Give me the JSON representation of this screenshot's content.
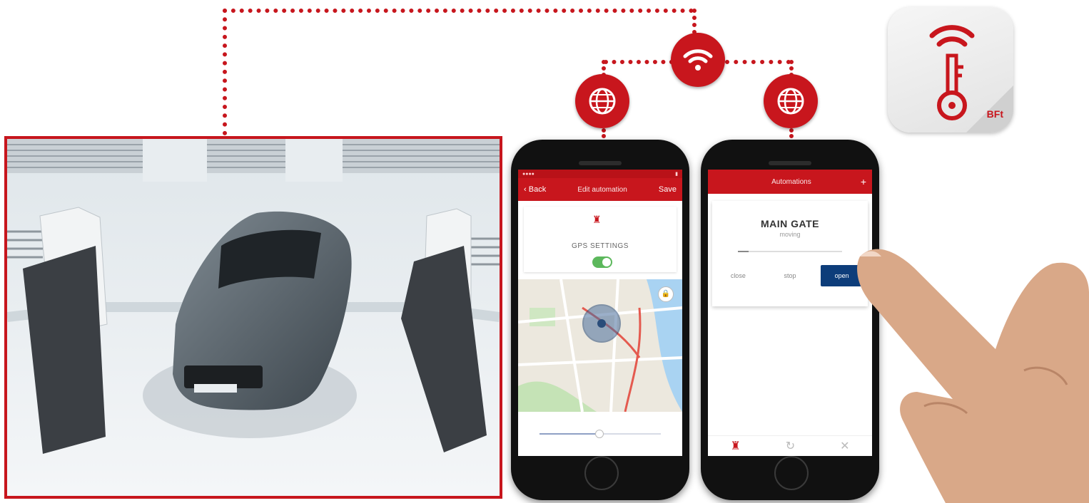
{
  "phone_settings": {
    "nav": {
      "back_label": "Back",
      "title": "Edit automation",
      "save_label": "Save"
    },
    "section_title": "GPS SETTINGS",
    "gps_enabled": true,
    "radius_fraction": 0.48
  },
  "phone_automations": {
    "nav": {
      "title": "Automations",
      "add_icon": "plus-icon"
    },
    "gate": {
      "name": "MAIN GATE",
      "status": "moving",
      "progress_fraction": 0.1,
      "close_label": "close",
      "stop_label": "stop",
      "open_label": "open"
    },
    "tabs": [
      "gate-icon",
      "history-icon",
      "settings-icon"
    ]
  },
  "app_icon": {
    "brand": "BFt",
    "color": "#c8161d"
  },
  "colors": {
    "accent": "#c8161d",
    "open_button": "#0d3d7a",
    "toggle_on": "#5cb85c"
  }
}
